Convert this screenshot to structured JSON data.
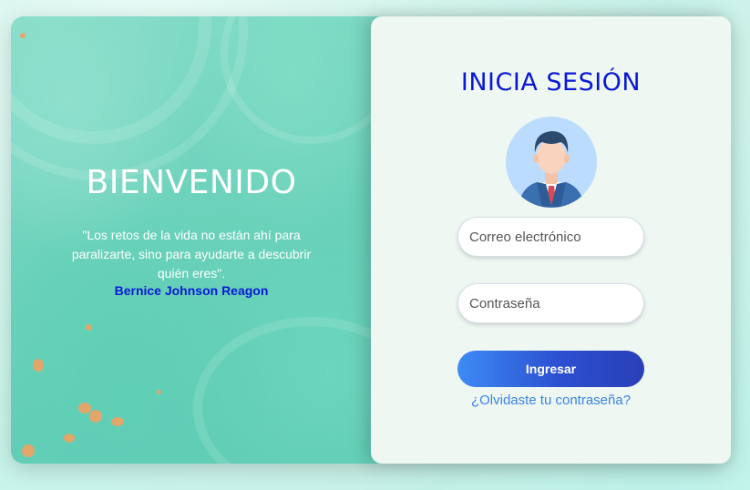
{
  "left_panel": {
    "title": "BIENVENIDO",
    "quote": "\"Los retos de la vida no están ahí para paralizarte, sino para ayudarte a descubrir quién eres\".",
    "author": "Bernice Johnson Reagon"
  },
  "login": {
    "title": "INICIA SESIÓN",
    "avatar_icon": "businessman-avatar-icon",
    "email_placeholder": "Correo electrónico",
    "password_placeholder": "Contraseña",
    "submit_label": "Ingresar",
    "forgot_link": "¿Olvidaste tu contraseña?"
  },
  "colors": {
    "title_blue": "#0a18d6",
    "link_blue": "#3a84e6",
    "panel_teal": "#6cd2bb",
    "form_bg": "#eef7f1"
  }
}
